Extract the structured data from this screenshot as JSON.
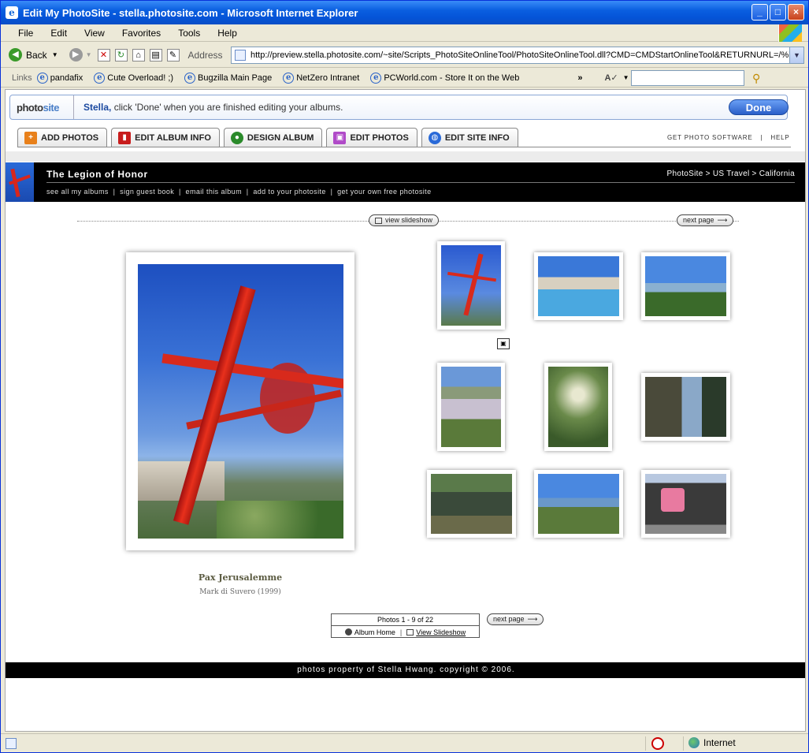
{
  "window": {
    "title": "Edit My PhotoSite - stella.photosite.com - Microsoft Internet Explorer"
  },
  "menu": [
    "File",
    "Edit",
    "View",
    "Favorites",
    "Tools",
    "Help"
  ],
  "toolbar": {
    "back": "Back",
    "address_label": "Address",
    "url": "http://preview.stella.photosite.com/~site/Scripts_PhotoSiteOnlineTool/PhotoSiteOnlineTool.dll?CMD=CMDStartOnlineTool&RETURNURL=/%7E:"
  },
  "links": {
    "label": "Links",
    "items": [
      "pandafix",
      "Cute Overload! ;)",
      "Bugzilla Main Page",
      "NetZero Intranet",
      "PCWorld.com - Store It on the Web"
    ]
  },
  "photosite": {
    "logo_a": "photo",
    "logo_b": "site",
    "user": "Stella,",
    "message": "click 'Done' when you are finished editing your albums.",
    "done": "Done"
  },
  "tabs": [
    "ADD PHOTOS",
    "EDIT ALBUM INFO",
    "DESIGN ALBUM",
    "EDIT PHOTOS",
    "EDIT SITE INFO"
  ],
  "toplinks": {
    "get": "GET PHOTO SOFTWARE",
    "sep": "|",
    "help": "HELP"
  },
  "album": {
    "title": "The Legion of Honor",
    "breadcrumb": "PhotoSite > US Travel > California",
    "sublinks": "see all my albums  |  sign guest book  |  email this album  |  add to your photosite  |  get your own free photosite",
    "view_slideshow": "view slideshow",
    "next_page": "next page",
    "caption_title": "Pax Jerusalemme",
    "caption_sub": "Mark di Suvero (1999)",
    "pager_count": "Photos 1 - 9 of 22",
    "album_home": "Album Home",
    "pager_slideshow": "View Slideshow",
    "footer": "photos property of Stella Hwang. copyright © 2006."
  },
  "status": {
    "zone": "Internet"
  },
  "colors": {
    "xp_blue": "#0454d8",
    "accent_red": "#d8261c",
    "header_black": "#000000"
  }
}
